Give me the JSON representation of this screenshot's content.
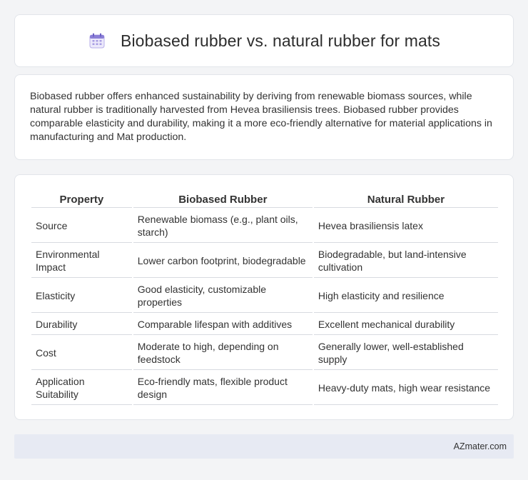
{
  "header": {
    "icon": "calendar-icon",
    "title": "Biobased rubber vs. natural rubber for mats"
  },
  "intro": {
    "text": "Biobased rubber offers enhanced sustainability by deriving from renewable biomass sources, while natural rubber is traditionally harvested from Hevea brasiliensis trees. Biobased rubber provides comparable elasticity and durability, making it a more eco-friendly alternative for material applications in manufacturing and Mat production."
  },
  "table": {
    "headers": [
      "Property",
      "Biobased Rubber",
      "Natural Rubber"
    ],
    "rows": [
      [
        "Source",
        "Renewable biomass (e.g., plant oils, starch)",
        "Hevea brasiliensis latex"
      ],
      [
        "Environmental Impact",
        "Lower carbon footprint, biodegradable",
        "Biodegradable, but land-intensive cultivation"
      ],
      [
        "Elasticity",
        "Good elasticity, customizable properties",
        "High elasticity and resilience"
      ],
      [
        "Durability",
        "Comparable lifespan with additives",
        "Excellent mechanical durability"
      ],
      [
        "Cost",
        "Moderate to high, depending on feedstock",
        "Generally lower, well-established supply"
      ],
      [
        "Application Suitability",
        "Eco-friendly mats, flexible product design",
        "Heavy-duty mats, high wear resistance"
      ]
    ]
  },
  "footer": {
    "brand": "AZmater.com"
  },
  "colors": {
    "background": "#f3f4f6",
    "card": "#ffffff",
    "footer": "#e7eaf3",
    "icon_accent": "#8b7fd6"
  }
}
